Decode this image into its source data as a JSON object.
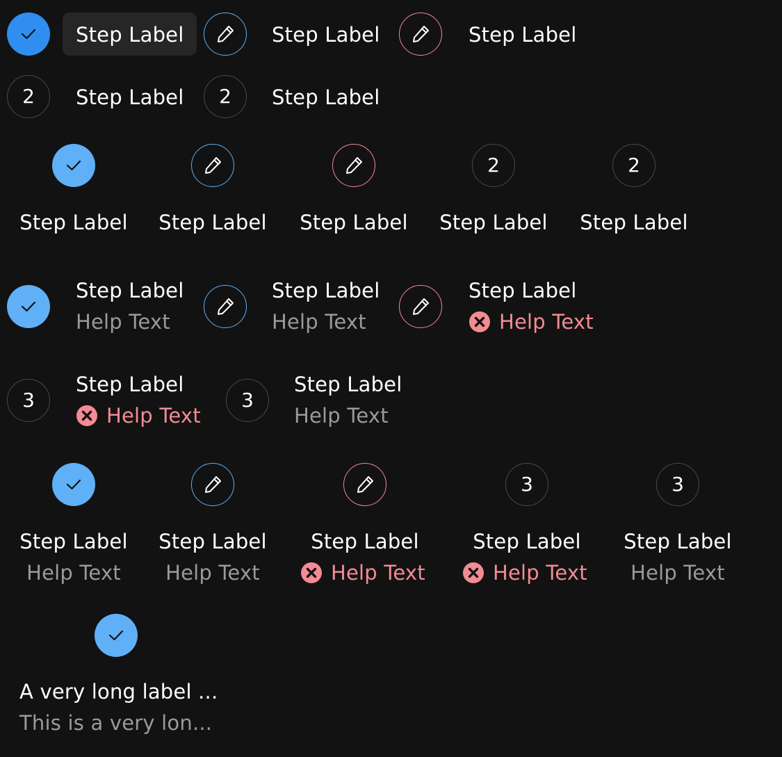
{
  "colors": {
    "background": "#121212",
    "completed_dark": "#2f8ef0",
    "completed_light": "#5fb0f7",
    "editing": "#5fb0f7",
    "error": "#f38b94",
    "idle_border": "#4a4a4a",
    "label": "#ffffff",
    "help": "#9a9a9a"
  },
  "icons": {
    "completed": "check-icon",
    "editing": "pencil-icon",
    "error_help": "error-circle-icon"
  },
  "row1": {
    "steps": [
      {
        "state": "completed",
        "label": "Step Label"
      },
      {
        "state": "editing",
        "label": "Step Label"
      },
      {
        "state": "error",
        "label": "Step Label"
      }
    ]
  },
  "row2": {
    "steps": [
      {
        "state": "idle",
        "number": "2",
        "label": "Step Label"
      },
      {
        "state": "idle",
        "number": "2",
        "label": "Step Label"
      }
    ]
  },
  "row3": {
    "steps": [
      {
        "state": "completed",
        "label": "Step Label"
      },
      {
        "state": "editing",
        "label": "Step Label"
      },
      {
        "state": "error",
        "label": "Step Label"
      },
      {
        "state": "idle",
        "number": "2",
        "label": "Step Label"
      },
      {
        "state": "idle",
        "number": "2",
        "label": "Step Label"
      }
    ]
  },
  "row4": {
    "steps": [
      {
        "state": "completed",
        "label": "Step Label",
        "help": "Help Text"
      },
      {
        "state": "editing",
        "label": "Step Label",
        "help": "Help Text"
      },
      {
        "state": "error",
        "label": "Step Label",
        "help": "Help Text"
      }
    ]
  },
  "row5": {
    "steps": [
      {
        "state": "idle",
        "number": "3",
        "label": "Step Label",
        "help": "Help Text"
      },
      {
        "state": "idle",
        "number": "3",
        "label": "Step Label",
        "help": "Help Text"
      }
    ]
  },
  "row6": {
    "steps": [
      {
        "state": "completed",
        "label": "Step Label",
        "help": "Help Text"
      },
      {
        "state": "editing",
        "label": "Step Label",
        "help": "Help Text"
      },
      {
        "state": "error",
        "label": "Step Label",
        "help": "Help Text"
      },
      {
        "state": "idle",
        "number": "3",
        "label": "Step Label",
        "help": "Help Text"
      },
      {
        "state": "idle",
        "number": "3",
        "label": "Step Label",
        "help": "Help Text"
      }
    ]
  },
  "row7": {
    "steps": [
      {
        "state": "completed",
        "label": "A very long label ...",
        "help": "This is a very lon..."
      }
    ]
  }
}
